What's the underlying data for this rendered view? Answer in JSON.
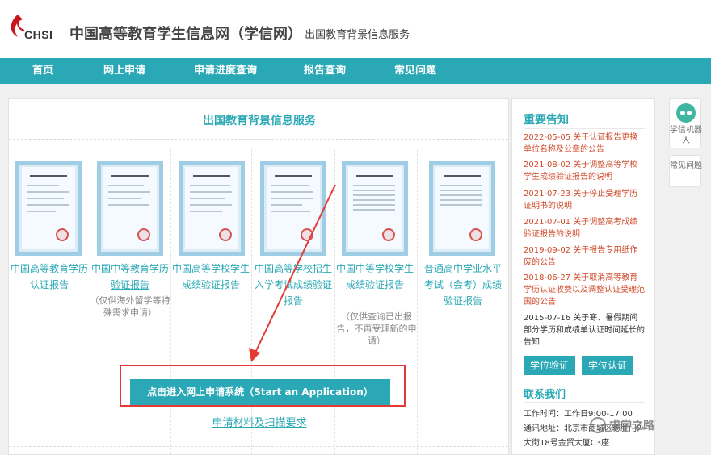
{
  "header": {
    "logo_text": "CHSI",
    "site_title": "中国高等教育学生信息网（学信网）",
    "site_sub": "— 出国教育背景信息服务"
  },
  "nav": [
    "首页",
    "网上申请",
    "申请进度查询",
    "报告查询",
    "常见问题"
  ],
  "main": {
    "title": "出国教育背景信息服务",
    "cards": [
      {
        "label": "中国高等教育学历认证报告",
        "note": ""
      },
      {
        "label": "中国中等教育学历验证报告",
        "note": "（仅供海外留学等特殊需求申请）"
      },
      {
        "label": "中国高等学校学生成绩验证报告",
        "note": ""
      },
      {
        "label": "中国高等学校招生入学考试成绩验证报告",
        "note": ""
      },
      {
        "label": "中国中等学校学生成绩验证报告",
        "note": "（仅供查询已出报告，不再受理新的申请）"
      },
      {
        "label": "普通高中学业水平考试（会考）成绩验证报告",
        "note": ""
      }
    ],
    "apply_button": "点击进入网上申请系统（Start an Application）",
    "requirements_link": "申请材料及扫描要求"
  },
  "sidebar": {
    "title": "重要告知",
    "notices": [
      {
        "text": "2022-05-05 关于认证报告更换单位名称及公章的公告",
        "color": "#d14a2a"
      },
      {
        "text": "2021-08-02 关于调整高等学校学生成绩验证报告的说明",
        "color": "#d14a2a"
      },
      {
        "text": "2021-07-23 关于停止受理学历证明书的说明",
        "color": "#d14a2a"
      },
      {
        "text": "2021-07-01 关于调整高考成绩验证报告的说明",
        "color": "#d14a2a"
      },
      {
        "text": "2019-09-02 关于报告专用纸作废的公告",
        "color": "#d14a2a"
      },
      {
        "text": "2018-06-27 关于取消高等教育学历认证收费以及调整认证受理范围的公告",
        "color": "#d14a2a"
      },
      {
        "text": "2015-07-16 关于寒、暑假期间部分学历和成绩单认证时间延长的告知",
        "color": "#333333"
      }
    ],
    "buttons": [
      "学位验证",
      "学位认证"
    ],
    "contact_title": "联系我们",
    "contact_lines": [
      "工作时间：工作日9:00-17:00",
      "通讯地址：北京市西城区德胜门外",
      "大街18号金贸大厦C3座"
    ]
  },
  "widgets": {
    "robot_label": "学信机器人",
    "faq_label": "常见问题"
  },
  "watermark": "求学之路",
  "colors": {
    "accent": "#2aa8b5",
    "notice_red": "#d14a2a",
    "highlight_red": "#e53935"
  }
}
